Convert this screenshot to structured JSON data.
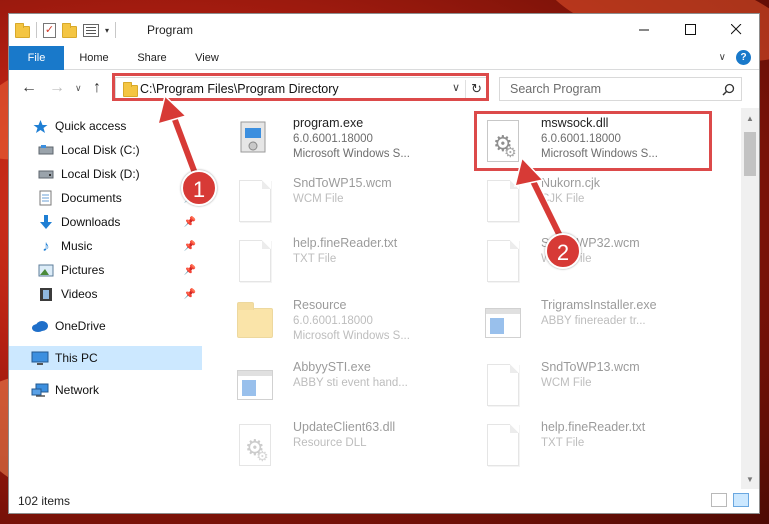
{
  "window": {
    "title": "Program"
  },
  "ribbon": {
    "tabs": [
      "File",
      "Home",
      "Share",
      "View"
    ]
  },
  "address": {
    "path": "C:\\Program Files\\Program Directory"
  },
  "search": {
    "placeholder": "Search Program"
  },
  "sidebar": {
    "items": [
      {
        "label": "Quick access",
        "icon": "star-icon"
      },
      {
        "label": "Local Disk (C:)",
        "icon": "drive-icon"
      },
      {
        "label": "Local Disk (D:)",
        "icon": "drive-icon"
      },
      {
        "label": "Documents",
        "icon": "documents-icon"
      },
      {
        "label": "Downloads",
        "icon": "download-arrow-icon"
      },
      {
        "label": "Music",
        "icon": "music-note-icon"
      },
      {
        "label": "Pictures",
        "icon": "pictures-icon"
      },
      {
        "label": "Videos",
        "icon": "film-icon"
      },
      {
        "label": "OneDrive",
        "icon": "cloud-icon"
      },
      {
        "label": "This PC",
        "icon": "monitor-icon"
      },
      {
        "label": "Network",
        "icon": "network-icon"
      }
    ]
  },
  "files": [
    {
      "name": "program.exe",
      "line1": "6.0.6001.18000",
      "line2": "Microsoft Windows S...",
      "icon": "installer-icon"
    },
    {
      "name": "mswsock.dll",
      "line1": "6.0.6001.18000",
      "line2": "Microsoft Windows S...",
      "icon": "dll-gear-icon"
    },
    {
      "name": "SndToWP15.wcm",
      "line1": "WCM File",
      "line2": "",
      "icon": "document-icon"
    },
    {
      "name": "Nukorn.cjk",
      "line1": "CJK File",
      "line2": "",
      "icon": "document-icon"
    },
    {
      "name": "help.fineReader.txt",
      "line1": "TXT File",
      "line2": "",
      "icon": "document-icon"
    },
    {
      "name": "SndToWP32.wcm",
      "line1": "WCM File",
      "line2": "",
      "icon": "document-icon"
    },
    {
      "name": "Resource",
      "line1": "6.0.6001.18000",
      "line2": "Microsoft Windows S...",
      "icon": "folder-icon"
    },
    {
      "name": "TrigramsInstaller.exe",
      "line1": "ABBY finereader tr...",
      "line2": "",
      "icon": "exe-window-icon"
    },
    {
      "name": "AbbyySTI.exe",
      "line1": "ABBY sti event hand...",
      "line2": "",
      "icon": "exe-window-icon"
    },
    {
      "name": "SndToWP13.wcm",
      "line1": "WCM File",
      "line2": "",
      "icon": "document-icon"
    },
    {
      "name": "UpdateClient63.dll",
      "line1": "Resource DLL",
      "line2": "",
      "icon": "dll-gear-icon"
    },
    {
      "name": "help.fineReader.txt",
      "line1": "TXT File",
      "line2": "",
      "icon": "document-icon"
    }
  ],
  "status": {
    "items_count": "102 items"
  },
  "callouts": [
    "1",
    "2"
  ],
  "colors": {
    "accent": "#1979ca",
    "highlight": "#dc4a4a",
    "selected": "#cce8ff"
  }
}
